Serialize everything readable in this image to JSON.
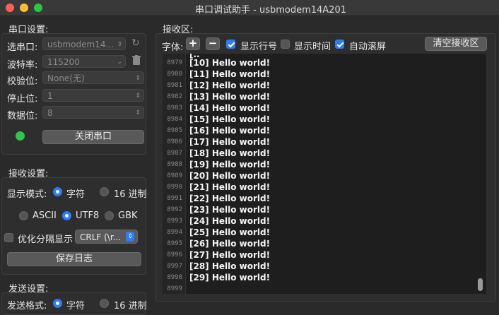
{
  "window": {
    "title": "串口调试助手 - usbmodem14A201"
  },
  "serial": {
    "section_title": "串口设置:",
    "port_label": "选串口:",
    "port_value": "usbmodem14...",
    "baud_label": "波特率:",
    "baud_value": "115200",
    "parity_label": "校验位:",
    "parity_value": "None(无)",
    "stop_label": "停止位:",
    "stop_value": "1",
    "data_label": "数据位:",
    "data_value": "8",
    "close_button": "关闭串口",
    "status_color": "#2fc64a"
  },
  "receive_settings": {
    "section_title": "接收设置:",
    "display_mode_label": "显示模式:",
    "mode_char": "字符",
    "mode_hex": "16 进制",
    "enc_ascii": "ASCII",
    "enc_utf8": "UTF8",
    "enc_gbk": "GBK",
    "optimize_label": "优化分隔显示",
    "separator_value": "CRLF (\\r...",
    "save_log_button": "保存日志"
  },
  "send_settings": {
    "section_title": "发送设置:",
    "send_mode_label": "发送格式:",
    "mode_char": "字符",
    "mode_hex": "16 进制"
  },
  "receive_area": {
    "section_title": "接收区:",
    "font_label": "字体:",
    "plus": "+",
    "minus": "−",
    "show_line_numbers": "显示行号",
    "show_time": "显示时间",
    "auto_scroll": "自动滚屏",
    "clear_button": "清空接收区",
    "lines": [
      {
        "n": "8979",
        "t": "[10] Hello world!"
      },
      {
        "n": "8980",
        "t": "[11] Hello world!"
      },
      {
        "n": "8981",
        "t": "[12] Hello world!"
      },
      {
        "n": "8982",
        "t": "[13] Hello world!"
      },
      {
        "n": "8983",
        "t": "[14] Hello world!"
      },
      {
        "n": "8984",
        "t": "[15] Hello world!"
      },
      {
        "n": "8985",
        "t": "[16] Hello world!"
      },
      {
        "n": "8986",
        "t": "[17] Hello world!"
      },
      {
        "n": "8987",
        "t": "[18] Hello world!"
      },
      {
        "n": "8988",
        "t": "[19] Hello world!"
      },
      {
        "n": "8989",
        "t": "[20] Hello world!"
      },
      {
        "n": "8990",
        "t": "[21] Hello world!"
      },
      {
        "n": "8991",
        "t": "[22] Hello world!"
      },
      {
        "n": "8992",
        "t": "[23] Hello world!"
      },
      {
        "n": "8993",
        "t": "[24] Hello world!"
      },
      {
        "n": "8994",
        "t": "[25] Hello world!"
      },
      {
        "n": "8995",
        "t": "[26] Hello world!"
      },
      {
        "n": "8996",
        "t": "[27] Hello world!"
      },
      {
        "n": "8997",
        "t": "[28] Hello world!"
      },
      {
        "n": "8998",
        "t": "[29] Hello world!"
      },
      {
        "n": "8999",
        "t": ""
      }
    ]
  }
}
